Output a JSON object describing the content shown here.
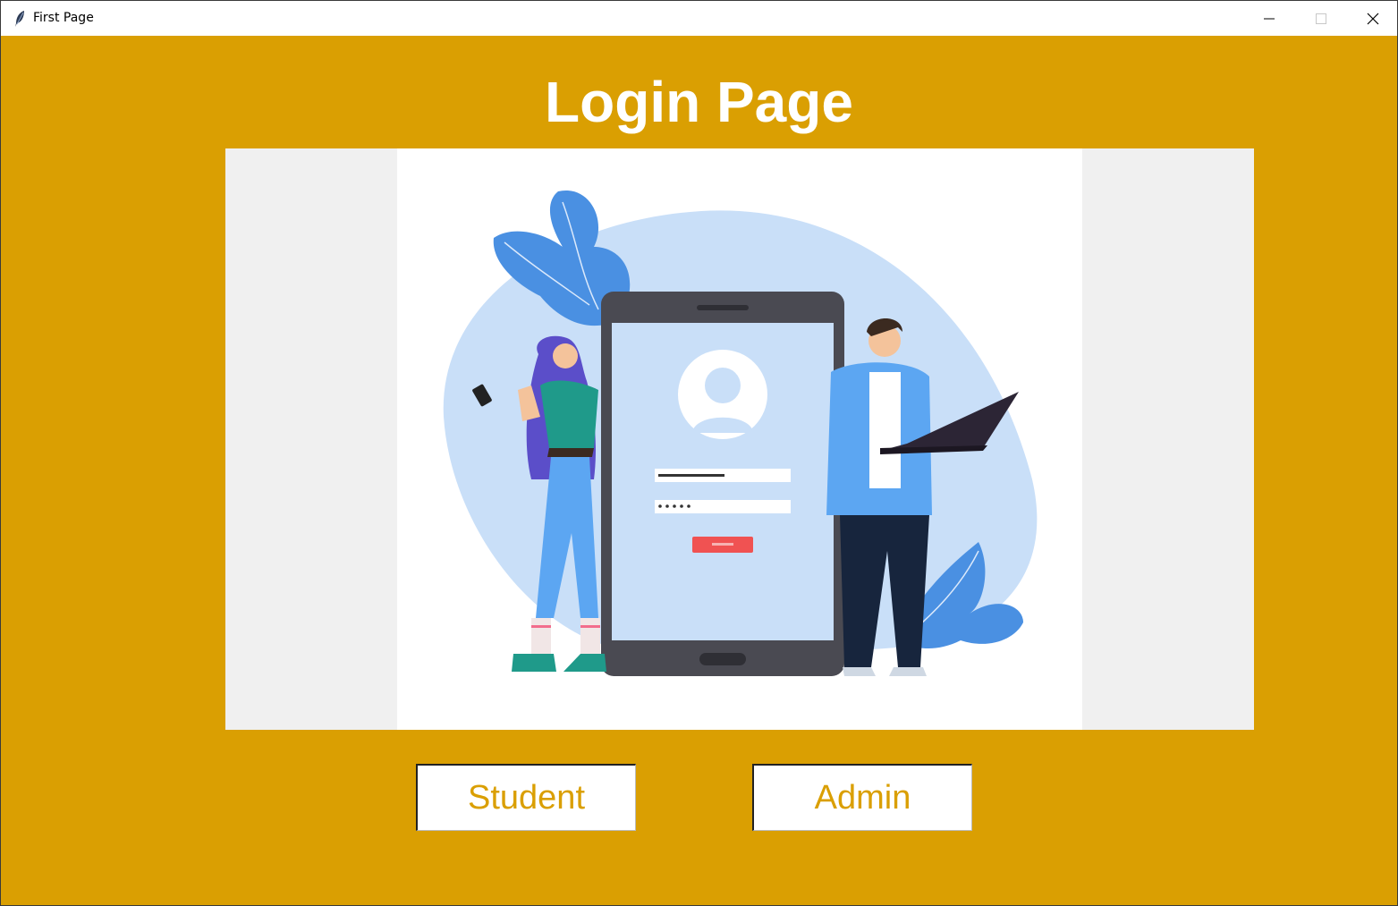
{
  "window": {
    "title": "First Page",
    "icon": "feather-icon"
  },
  "page": {
    "heading": "Login Page"
  },
  "illustration": {
    "description_icon": "login-illustration"
  },
  "buttons": {
    "student": "Student",
    "admin": "Admin"
  },
  "colors": {
    "background": "#DA9F02",
    "button_text": "#DA9F02",
    "heading": "#FFFFFF"
  }
}
